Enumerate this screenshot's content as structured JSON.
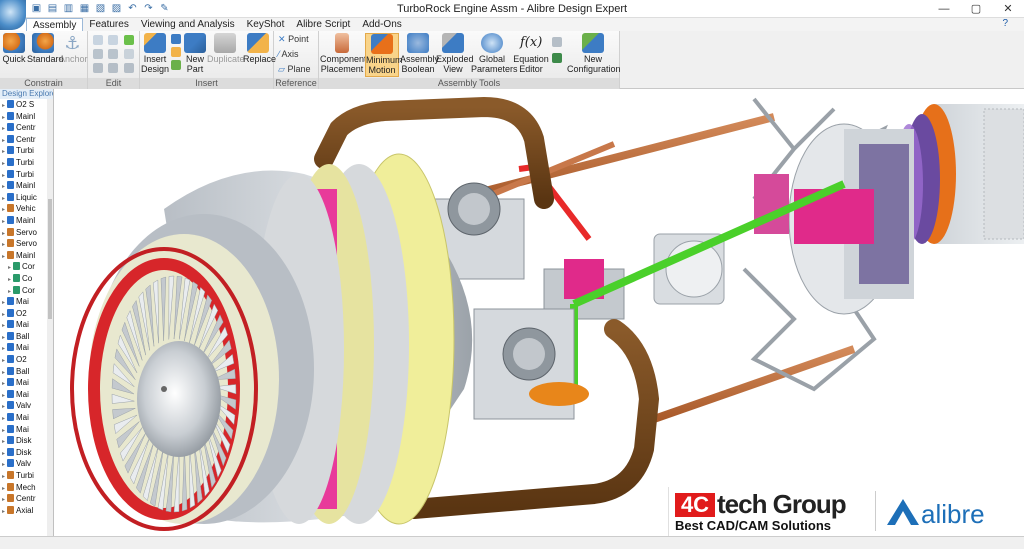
{
  "window": {
    "title": "TurboRock Engine Assm - Alibre Design Expert",
    "controls": [
      "—",
      "▢",
      "✕"
    ]
  },
  "menu": {
    "tabs": [
      "Assembly",
      "Features",
      "Viewing and Analysis",
      "KeyShot",
      "Alibre Script",
      "Add-Ons"
    ],
    "active": "Assembly",
    "help": "?"
  },
  "ribbon": {
    "constrain": {
      "label": "Constrain",
      "quick": "Quick",
      "standard": "Standard",
      "anchor": "Anchor"
    },
    "edit": {
      "label": "Edit"
    },
    "insert": {
      "label": "Insert",
      "insert_design": [
        "Insert",
        "Design"
      ],
      "new_part": [
        "New",
        "Part"
      ],
      "duplicate": "Duplicate",
      "replace": "Replace"
    },
    "reference": {
      "label": "Reference",
      "point": "Point",
      "axis": "Axis",
      "plane": "Plane"
    },
    "tools": {
      "label": "Assembly Tools",
      "component_placement": [
        "Component",
        "Placement"
      ],
      "minimum_motion": [
        "Minimum",
        "Motion"
      ],
      "assembly_boolean": [
        "Assembly",
        "Boolean"
      ],
      "exploded_view": [
        "Exploded",
        "View"
      ],
      "global_parameters": [
        "Global",
        "Parameters"
      ],
      "equation_editor": [
        "Equation",
        "Editor"
      ],
      "new_configuration": [
        "New",
        "Configuration"
      ]
    }
  },
  "tree": {
    "title": "Design Explorer",
    "items": [
      {
        "label": "O2 S",
        "color": "#2a6fc9"
      },
      {
        "label": "Mainl",
        "color": "#2a6fc9"
      },
      {
        "label": "Centr",
        "color": "#2a6fc9"
      },
      {
        "label": "Centr",
        "color": "#2a6fc9"
      },
      {
        "label": "Turbi",
        "color": "#2a6fc9"
      },
      {
        "label": "Turbi",
        "color": "#2a6fc9"
      },
      {
        "label": "Turbi",
        "color": "#2a6fc9"
      },
      {
        "label": "Mainl",
        "color": "#2a6fc9"
      },
      {
        "label": "Liquic",
        "color": "#2a6fc9"
      },
      {
        "label": "Vehic",
        "color": "#c8762a"
      },
      {
        "label": "Mainl",
        "color": "#2a6fc9"
      },
      {
        "label": "Servo",
        "color": "#c8762a"
      },
      {
        "label": "Servo",
        "color": "#c8762a"
      },
      {
        "label": "Mainl",
        "color": "#c8762a"
      },
      {
        "label": "Cor",
        "color": "#2a9a6a"
      },
      {
        "label": "Co",
        "color": "#2a9a6a"
      },
      {
        "label": "Cor",
        "color": "#2a9a6a"
      },
      {
        "label": "Mai",
        "color": "#2a6fc9"
      },
      {
        "label": "O2",
        "color": "#2a6fc9"
      },
      {
        "label": "Mai",
        "color": "#2a6fc9"
      },
      {
        "label": "Ball",
        "color": "#2a6fc9"
      },
      {
        "label": "Mai",
        "color": "#2a6fc9"
      },
      {
        "label": "O2",
        "color": "#2a6fc9"
      },
      {
        "label": "Ball",
        "color": "#2a6fc9"
      },
      {
        "label": "Mai",
        "color": "#2a6fc9"
      },
      {
        "label": "Mai",
        "color": "#2a6fc9"
      },
      {
        "label": "Valv",
        "color": "#2a6fc9"
      },
      {
        "label": "Mai",
        "color": "#2a6fc9"
      },
      {
        "label": "Mai",
        "color": "#2a6fc9"
      },
      {
        "label": "Disk",
        "color": "#2a6fc9"
      },
      {
        "label": "Disk",
        "color": "#2a6fc9"
      },
      {
        "label": "Valv",
        "color": "#2a6fc9"
      },
      {
        "label": "Turbi",
        "color": "#c8762a"
      },
      {
        "label": "Mech",
        "color": "#c8762a"
      },
      {
        "label": "Centr",
        "color": "#c8762a"
      },
      {
        "label": "Axial",
        "color": "#c8762a"
      }
    ]
  },
  "brand": {
    "fourc": "4C",
    "ctech": "tech Group",
    "slogan": "Best CAD/CAM Solutions",
    "alibre": "alibre"
  }
}
